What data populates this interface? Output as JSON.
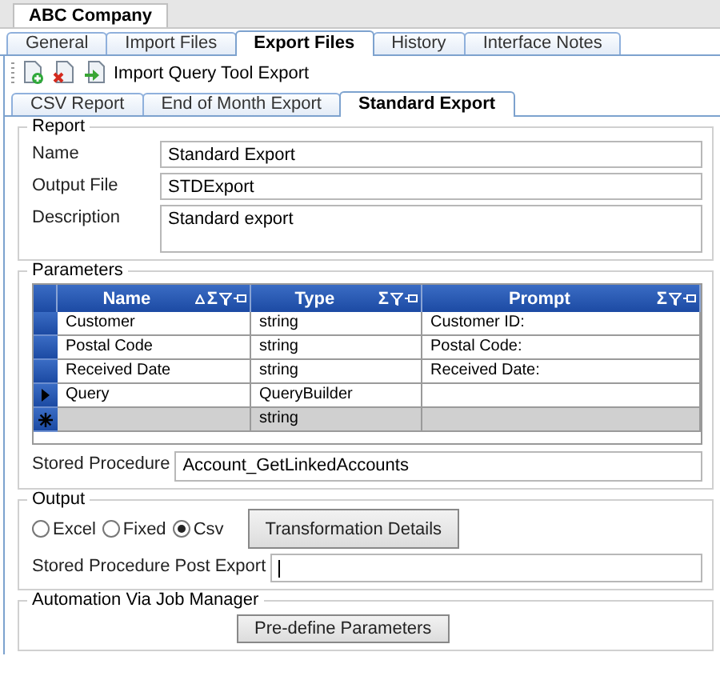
{
  "document_tab": "ABC Company",
  "tabs": [
    {
      "label": "General",
      "selected": false
    },
    {
      "label": "Import Files",
      "selected": false
    },
    {
      "label": "Export Files",
      "selected": true
    },
    {
      "label": "History",
      "selected": false
    },
    {
      "label": "Interface Notes",
      "selected": false
    }
  ],
  "toolbar": {
    "label": "Import Query Tool Export"
  },
  "subtabs": [
    {
      "label": "CSV Report",
      "selected": false
    },
    {
      "label": "End of Month Export",
      "selected": false
    },
    {
      "label": "Standard Export",
      "selected": true
    }
  ],
  "report": {
    "title": "Report",
    "fields": [
      {
        "label": "Name",
        "value": "Standard Export",
        "kind": "single"
      },
      {
        "label": "Output File",
        "value": "STDExport",
        "kind": "single"
      },
      {
        "label": "Description",
        "value": "Standard export",
        "kind": "multiline"
      }
    ]
  },
  "parameters": {
    "title": "Parameters",
    "columns": [
      {
        "name": "Name",
        "sorted": true,
        "summary": "Σ"
      },
      {
        "name": "Type",
        "sorted": false,
        "summary": "Σ"
      },
      {
        "name": "Prompt",
        "sorted": false,
        "summary": "Σ"
      }
    ],
    "rows": [
      {
        "kind": "data",
        "current": false,
        "cells": [
          "Customer",
          "string",
          "Customer ID:"
        ]
      },
      {
        "kind": "data",
        "current": false,
        "cells": [
          "Postal Code",
          "string",
          "Postal Code:"
        ]
      },
      {
        "kind": "data",
        "current": false,
        "cells": [
          "Received Date",
          "string",
          "Received Date:"
        ]
      },
      {
        "kind": "data",
        "current": true,
        "cells": [
          "Query",
          "QueryBuilder",
          ""
        ]
      },
      {
        "kind": "new",
        "current": false,
        "cells": [
          "",
          "string",
          ""
        ]
      }
    ],
    "stored_procedure": {
      "label": "Stored Procedure",
      "value": "Account_GetLinkedAccounts"
    }
  },
  "output": {
    "title": "Output",
    "formats": [
      {
        "label": "Excel",
        "selected": false
      },
      {
        "label": "Fixed",
        "selected": false
      },
      {
        "label": "Csv",
        "selected": true
      }
    ],
    "button": "Transformation Details",
    "post_export": {
      "label": "Stored Procedure Post Export",
      "focused": true
    }
  },
  "automation": {
    "title": "Automation Via Job Manager",
    "button": "Pre-define Parameters"
  }
}
